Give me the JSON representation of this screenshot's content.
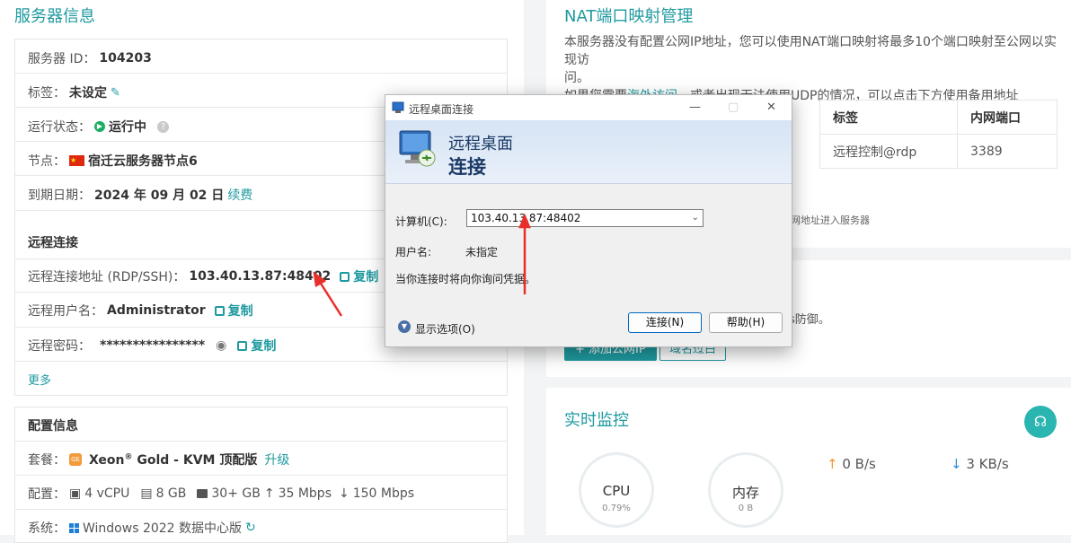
{
  "left": {
    "title": "服务器信息",
    "server_id_label": "服务器 ID：",
    "server_id": "104203",
    "tag_label": "标签：",
    "tag_value": "未设定",
    "status_label": "运行状态：",
    "status_value": "运行中",
    "node_label": "节点：",
    "node_value": "宿迁云服务器节点6",
    "expire_label": "到期日期：",
    "expire_value": "2024 年 09 月 02 日",
    "renew": "续费",
    "remote_title": "远程连接",
    "remote_addr_label": "远程连接地址 (RDP/SSH)：",
    "remote_addr": "103.40.13.87:48402",
    "copy": "复制",
    "remote_user_label": "远程用户名：",
    "remote_user": "Administrator",
    "remote_pwd_label": "远程密码：",
    "remote_pwd": "****************",
    "more": "更多",
    "config_title": "配置信息",
    "package_label": "套餐：",
    "package_chip": "GE",
    "package_value_pre": "Xeon",
    "package_value_sup": "®",
    "package_value_post": " Gold - KVM 顶配版",
    "upgrade": "升级",
    "spec_label": "配置：",
    "spec_cpu": "4 vCPU",
    "spec_ram": "8 GB",
    "spec_disk": "30+ GB",
    "spec_up": "35 Mbps",
    "spec_down": "150 Mbps",
    "os_label": "系统：",
    "os_value": "Windows 2022 数据中心版"
  },
  "nat": {
    "title": "NAT端口映射管理",
    "desc1": "本服务器没有配置公网IP地址，您可以使用NAT端口映射将最多10个端口映射至公网以实现访",
    "desc2": "问。",
    "desc3_pre": "如果您需要",
    "desc3_link": "海外访问",
    "desc3_post": "，或者出现无法使用UDP的情况，可以点击下方使用备用地址",
    "col_tag": "标签",
    "col_port": "内网端口",
    "row_tag": "远程控制@rdp",
    "row_port": "3389",
    "note": "网地址进入服务器"
  },
  "mid": {
    "text": "s防御。",
    "btn_add": "+ 添加公网IP",
    "btn_domain": "域名过白"
  },
  "monitor": {
    "title": "实时监控",
    "cpu_label": "CPU",
    "cpu_value": "0.79%",
    "mem_label": "内存",
    "mem_value": "0 B",
    "up": "0 B/s",
    "down": "3 KB/s"
  },
  "dialog": {
    "title": "远程桌面连接",
    "banner1": "远程桌面",
    "banner2": "连接",
    "computer_label": "计算机(C):",
    "computer_value": "103.40.13.87:48402",
    "user_label": "用户名:",
    "user_value": "未指定",
    "hint": "当你连接时将向你询问凭据。",
    "options": "显示选项(O)",
    "connect": "连接(N)",
    "help": "帮助(H)"
  },
  "colors": {
    "accent": "#1f9aa0",
    "annotation": "#e8302a"
  }
}
